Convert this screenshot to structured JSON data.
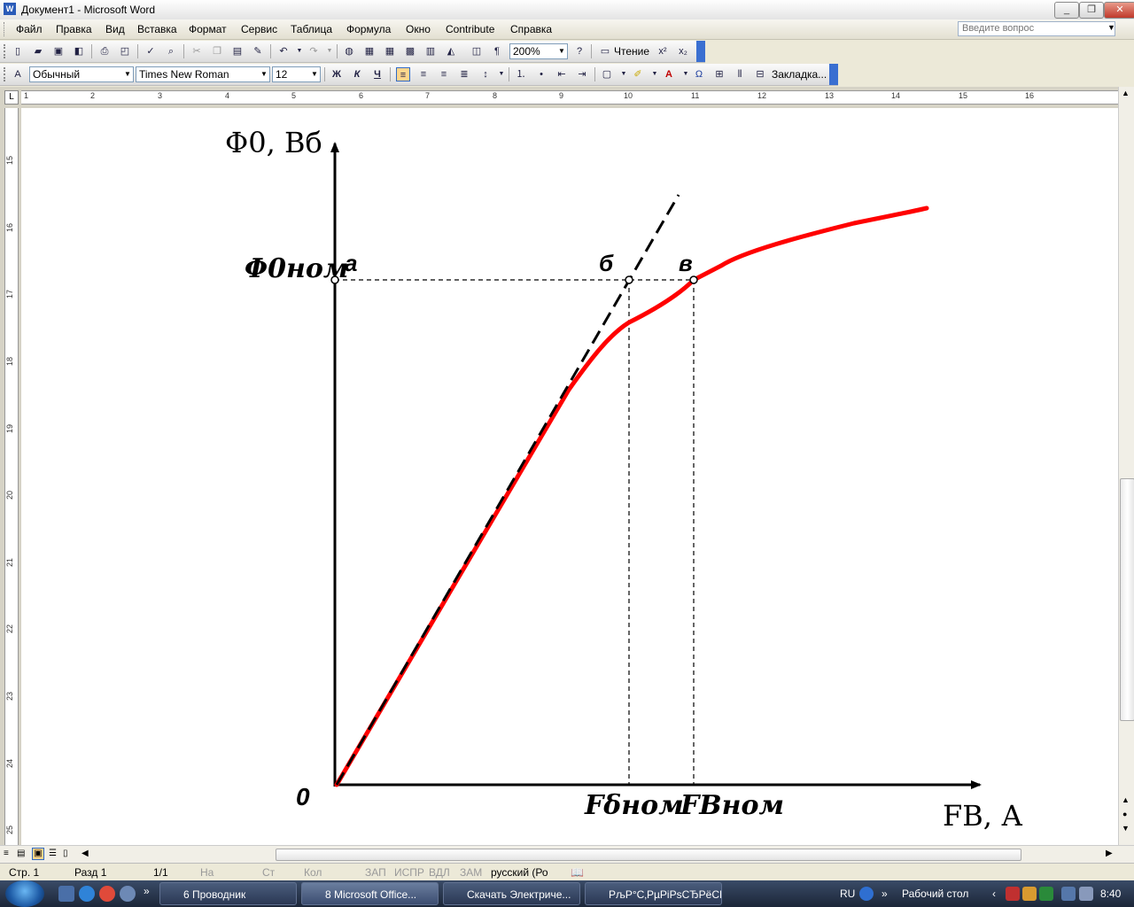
{
  "window": {
    "title": "Документ1 - Microsoft Word",
    "app_icon": "W",
    "minimize": "_",
    "restore": "❐",
    "close": "✕"
  },
  "menu": {
    "items": [
      "Файл",
      "Правка",
      "Вид",
      "Вставка",
      "Формат",
      "Сервис",
      "Таблица",
      "Формула",
      "Окно",
      "Contribute",
      "Справка"
    ],
    "help_placeholder": "Введите вопрос"
  },
  "toolbar1": {
    "zoom": "200%",
    "reading_label": "Чтение"
  },
  "toolbar2": {
    "style": "Обычный",
    "font": "Times New Roman",
    "size": "12",
    "bold": "Ж",
    "italic": "К",
    "underline": "Ч",
    "bookmark": "Закладка..."
  },
  "ruler": {
    "h_numbers": [
      "1",
      "1",
      "2",
      "3",
      "4",
      "5",
      "6",
      "7",
      "8",
      "9",
      "10",
      "11",
      "12",
      "13",
      "14",
      "15",
      "16"
    ],
    "v_numbers": [
      "15",
      "16",
      "17",
      "18",
      "19",
      "20",
      "21",
      "22",
      "23",
      "24",
      "25"
    ]
  },
  "figure": {
    "y_axis_label": "Φ0, Вб",
    "y_value_label": "Φ0ном",
    "x_axis_label": "FB, А",
    "origin_label": "0",
    "point_a": "а",
    "point_b": "б",
    "point_v": "в",
    "x_mark_1": "Fδном",
    "x_mark_2": "FBном",
    "colors": {
      "curve": "#ff0000",
      "tangent": "#000000",
      "axes": "#000000"
    }
  },
  "status": {
    "page": "Стр. 1",
    "section": "Разд 1",
    "pages": "1/1",
    "at": "На",
    "line": "Ст",
    "col": "Кол",
    "rec": "ЗАП",
    "trk": "ИСПР",
    "ext": "ВДЛ",
    "ovr": "ЗАМ",
    "lang": "русский (Ро"
  },
  "taskbar": {
    "tasks": [
      "6 Проводник",
      "8 Microsoft Office...",
      "Скачать Электриче...",
      "РљР°С‚РµРіРѕСЂРёСЏ..."
    ],
    "lang": "RU",
    "desktop": "Рабочий стол",
    "clock": "8:40"
  }
}
